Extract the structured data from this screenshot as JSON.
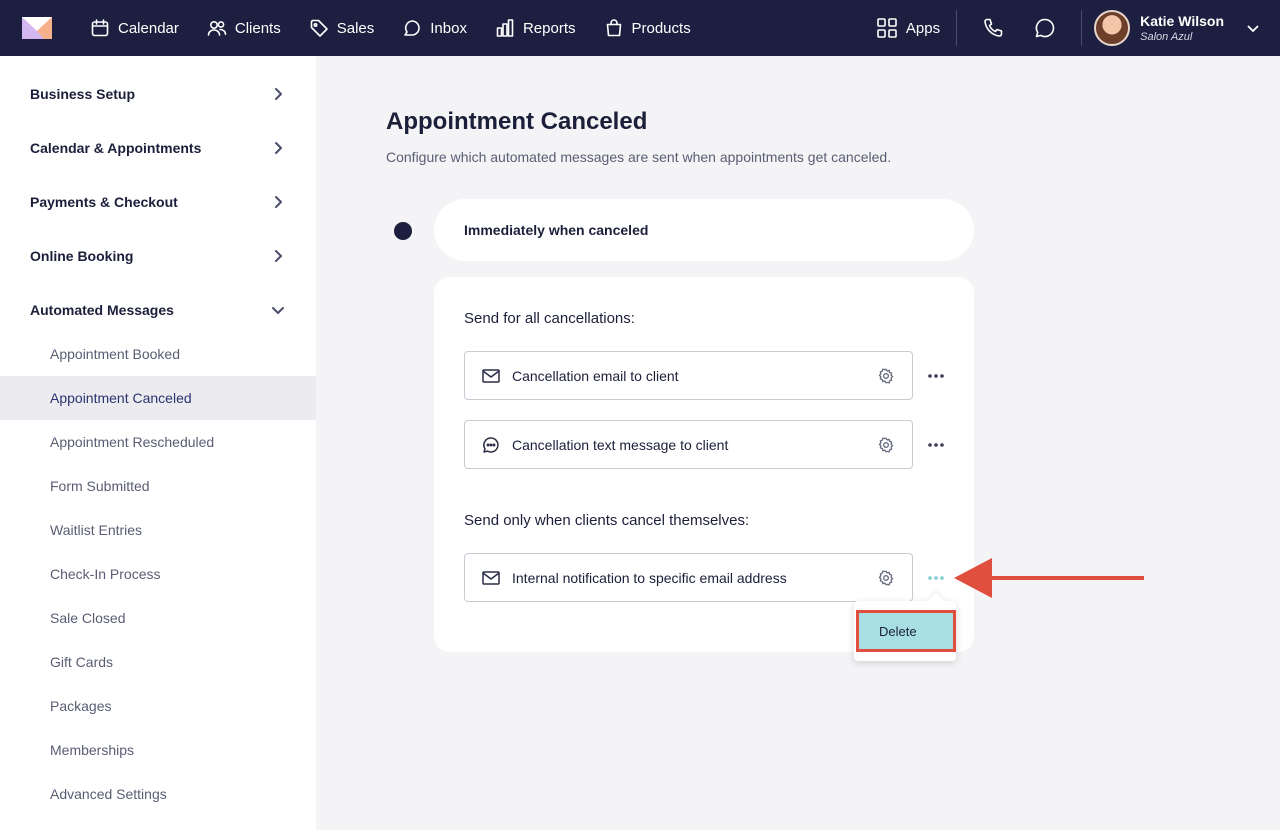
{
  "topnav": {
    "items": [
      {
        "label": "Calendar",
        "icon": "calendar-icon"
      },
      {
        "label": "Clients",
        "icon": "users-icon"
      },
      {
        "label": "Sales",
        "icon": "tag-icon"
      },
      {
        "label": "Inbox",
        "icon": "chat-bubble-icon"
      },
      {
        "label": "Reports",
        "icon": "bar-chart-icon"
      },
      {
        "label": "Products",
        "icon": "shopping-bag-icon"
      }
    ],
    "apps_label": "Apps",
    "user": {
      "name": "Katie Wilson",
      "salon": "Salon Azul"
    }
  },
  "sidebar": {
    "sections": [
      {
        "label": "Business Setup",
        "expanded": false
      },
      {
        "label": "Calendar & Appointments",
        "expanded": false
      },
      {
        "label": "Payments & Checkout",
        "expanded": false
      },
      {
        "label": "Online Booking",
        "expanded": false
      },
      {
        "label": "Automated Messages",
        "expanded": true
      }
    ],
    "subitems": [
      "Appointment Booked",
      "Appointment Canceled",
      "Appointment Rescheduled",
      "Form Submitted",
      "Waitlist Entries",
      "Check-In Process",
      "Sale Closed",
      "Gift Cards",
      "Packages",
      "Memberships",
      "Advanced Settings"
    ],
    "active_subitem": "Appointment Canceled"
  },
  "main": {
    "title": "Appointment Canceled",
    "subtitle": "Configure which automated messages are sent when appointments get canceled.",
    "trigger": "Immediately when canceled",
    "group_all": "Send for all cancellations:",
    "group_self": "Send only when clients cancel themselves:",
    "messages": [
      {
        "label": "Cancellation email to client",
        "icon": "envelope-icon"
      },
      {
        "label": "Cancellation text message to client",
        "icon": "speech-bubble-icon"
      },
      {
        "label": "Internal notification to specific email address",
        "icon": "envelope-icon"
      }
    ],
    "menu": {
      "delete_label": "Delete"
    }
  },
  "colors": {
    "nav_bg": "#1c1f3f",
    "accent_highlight": "#a7dfe3",
    "annotation_red": "#e04f3e",
    "active_more": "#7ccbd4"
  }
}
